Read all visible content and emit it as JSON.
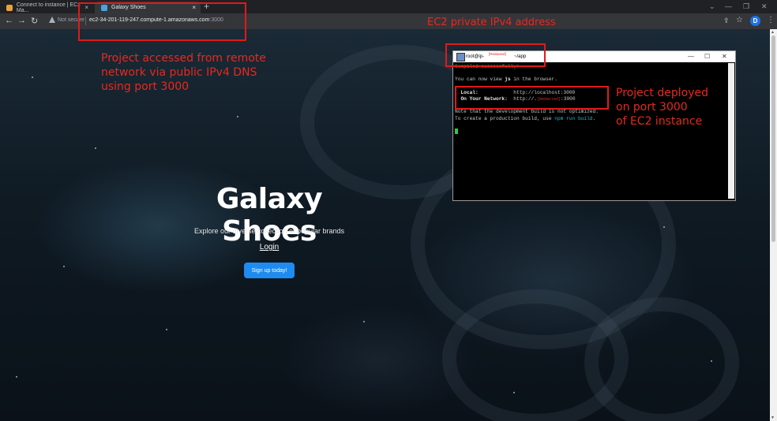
{
  "browser": {
    "tabs": [
      {
        "title": "Connect to instance | EC2 Ma..."
      },
      {
        "title": "Galaxy Shoes"
      }
    ],
    "new_tab_symbol": "+",
    "security_label": "Not secure",
    "url_host": "ec2-34-201-119-247.compute-1.amazonaws.com",
    "url_port": ":3000",
    "profile_initial": "D",
    "icons": [
      "back-arrow-icon",
      "forward-arrow-icon",
      "reload-icon",
      "warning-icon",
      "share-icon",
      "star-icon",
      "menu-icon"
    ]
  },
  "page": {
    "title": "Galaxy Shoes",
    "subtitle": "Explore our diverse collection of popular brands",
    "login_label": "Login",
    "signup_label": "Sign up today!",
    "accent_color": "#1e8bf0"
  },
  "terminal": {
    "window_user": "root@ip-",
    "redacted_label": "[Redacted]",
    "window_dir": "~/app",
    "lines": {
      "compiled": "Compiled successfully!",
      "view_prefix": "You can now view ",
      "view_app": "js",
      "view_suffix": " in the browser.",
      "local_label": "Local:",
      "local_url": "http://localhost:3000",
      "network_label": "On Your Network:",
      "network_prefix": "http://.",
      "network_suffix": ":3000",
      "note": "Note that the development build is not optimized.",
      "create_prefix": "To create a production build, use ",
      "create_cmd": "npm run build",
      "create_suffix": "."
    }
  },
  "annotations": {
    "top_label": "EC2 private IPv4 address",
    "left_label": [
      "Project accessed from remote",
      "network via public IPv4 DNS",
      "using port 3000"
    ],
    "right_label": [
      "Project deployed",
      "on port 3000",
      "of EC2 instance"
    ],
    "color": "#e01a1a"
  }
}
